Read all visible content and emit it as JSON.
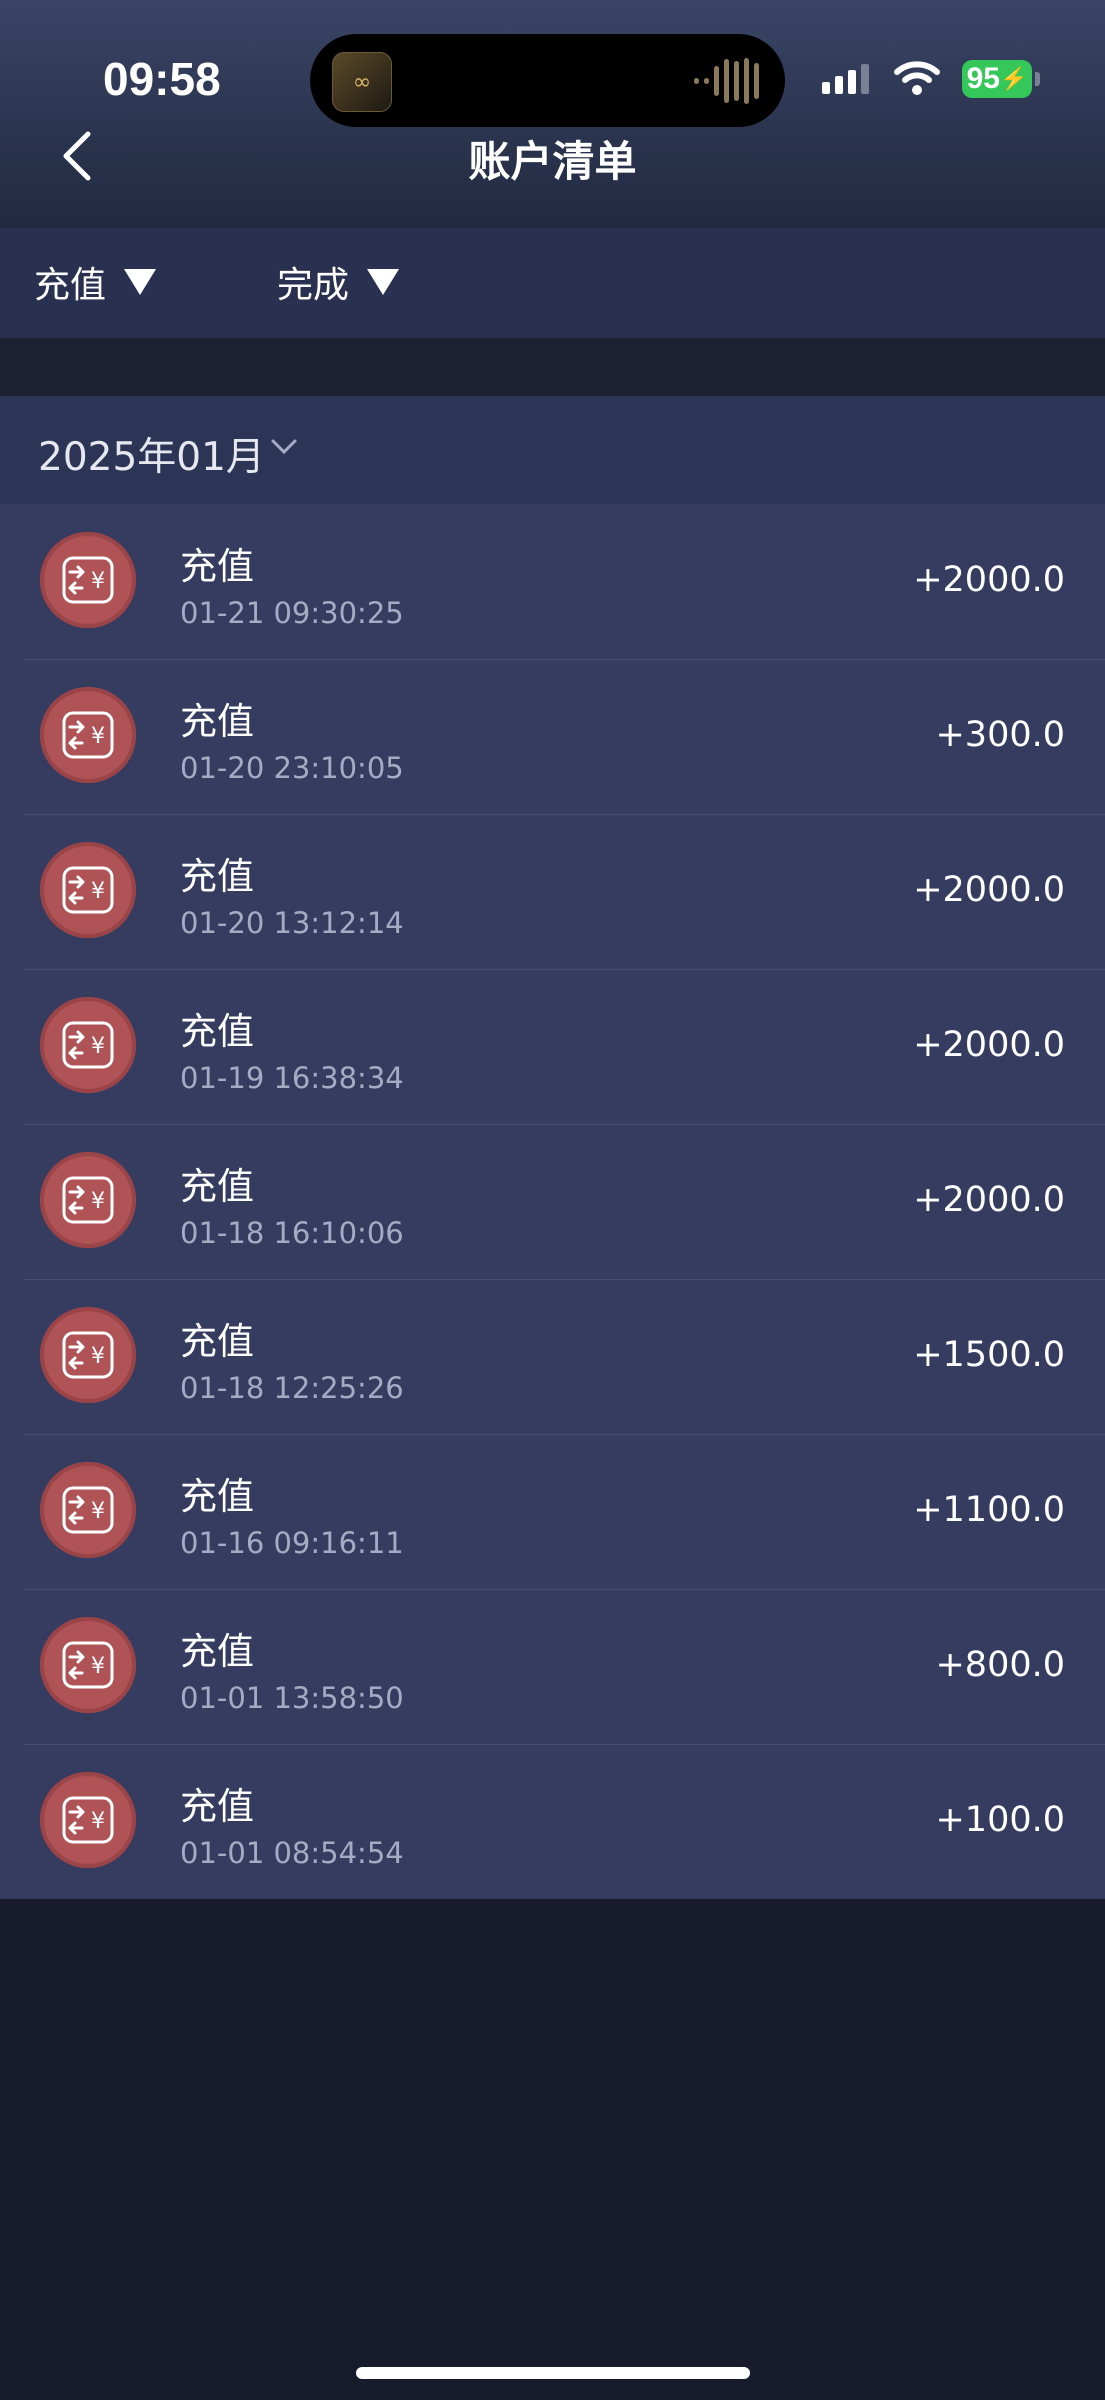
{
  "status_bar": {
    "time": "09:58",
    "battery": "95"
  },
  "header": {
    "title": "账户清单"
  },
  "filters": [
    {
      "label": "充值"
    },
    {
      "label": "完成"
    }
  ],
  "month": {
    "label": "2025年01月"
  },
  "transactions": [
    {
      "title": "充值",
      "time": "01-21 09:30:25",
      "amount": "+2000.0"
    },
    {
      "title": "充值",
      "time": "01-20 23:10:05",
      "amount": "+300.0"
    },
    {
      "title": "充值",
      "time": "01-20 13:12:14",
      "amount": "+2000.0"
    },
    {
      "title": "充值",
      "time": "01-19 16:38:34",
      "amount": "+2000.0"
    },
    {
      "title": "充值",
      "time": "01-18 16:10:06",
      "amount": "+2000.0"
    },
    {
      "title": "充值",
      "time": "01-18 12:25:26",
      "amount": "+1500.0"
    },
    {
      "title": "充值",
      "time": "01-16 09:16:11",
      "amount": "+1100.0"
    },
    {
      "title": "充值",
      "time": "01-01 13:58:50",
      "amount": "+800.0"
    },
    {
      "title": "充值",
      "time": "01-01 08:54:54",
      "amount": "+100.0"
    }
  ],
  "colors": {
    "icon_bg": "#b05357",
    "list_bg": "#363c60",
    "page_bg": "#181b2b"
  },
  "icons": {
    "row_icon": "recharge-yen-icon",
    "back": "chevron-left-icon",
    "month_toggle": "chevron-down-icon"
  }
}
